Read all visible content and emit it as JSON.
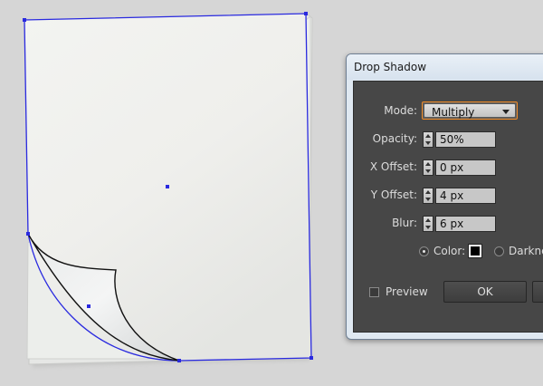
{
  "dialog": {
    "title": "Drop Shadow",
    "mode": {
      "label": "Mode:",
      "value": "Multiply"
    },
    "opacity": {
      "label": "Opacity:",
      "value": "50%"
    },
    "x_offset": {
      "label": "X Offset:",
      "value": "0 px"
    },
    "y_offset": {
      "label": "Y Offset:",
      "value": "4 px"
    },
    "blur": {
      "label": "Blur:",
      "value": "6 px"
    },
    "color_option": {
      "label": "Color:",
      "selected": true,
      "swatch": "#000000"
    },
    "darkness_option": {
      "label": "Darkne",
      "selected": false
    },
    "preview": {
      "label": "Preview",
      "checked": false
    },
    "ok_label": "OK"
  },
  "colors": {
    "workspace_bg": "#d6d6d6",
    "panel_bg": "#474747",
    "focus_outline": "#f28c28",
    "selection_path": "#2a2adf"
  }
}
